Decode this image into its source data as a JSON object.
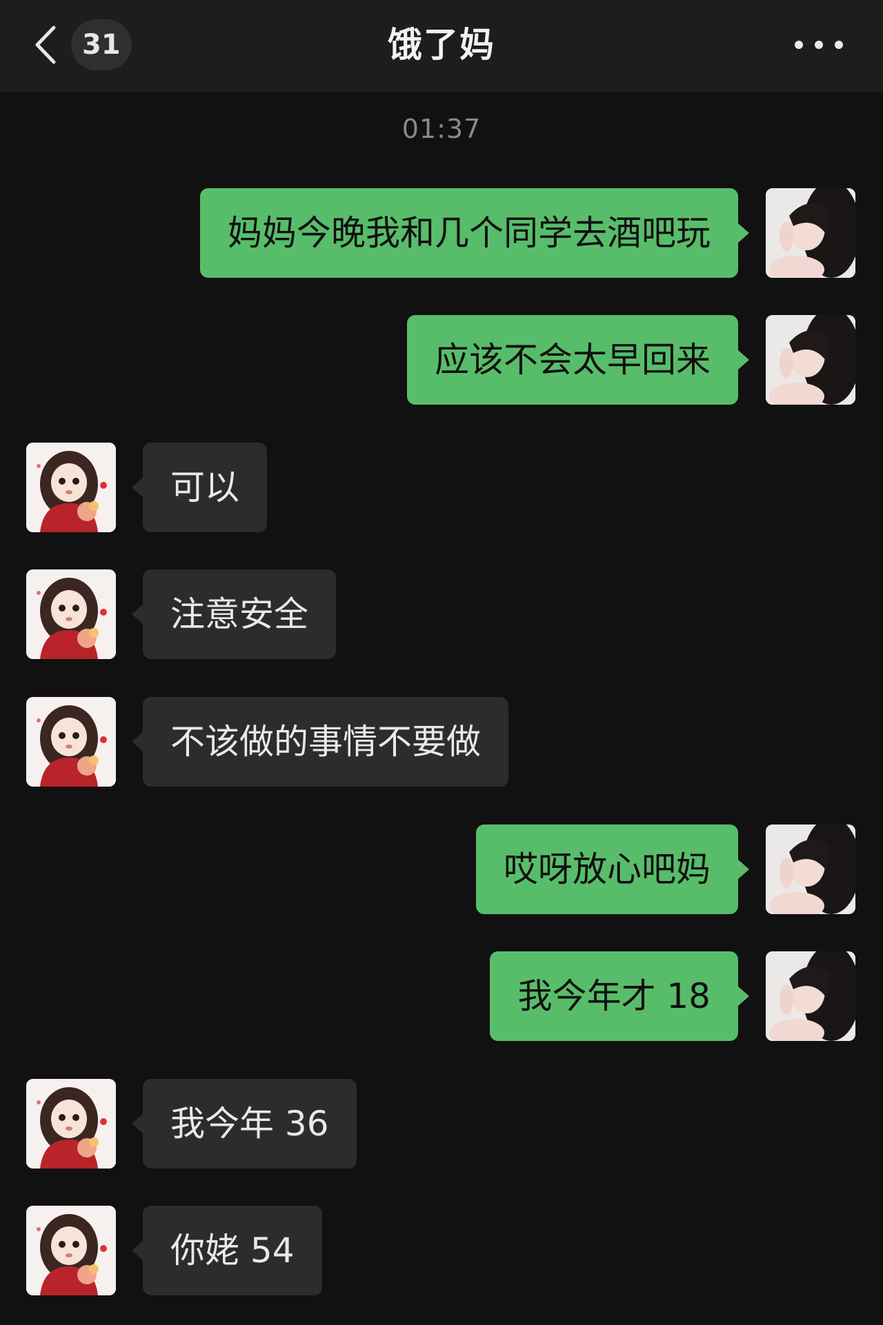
{
  "header": {
    "unread_count": "31",
    "title": "饿了妈"
  },
  "timestamp": "01:37",
  "messages": [
    {
      "side": "out",
      "text": "妈妈今晚我和几个同学去酒吧玩"
    },
    {
      "side": "out",
      "text": "应该不会太早回来"
    },
    {
      "side": "in",
      "text": "可以"
    },
    {
      "side": "in",
      "text": "注意安全"
    },
    {
      "side": "in",
      "text": "不该做的事情不要做"
    },
    {
      "side": "out",
      "text": "哎呀放心吧妈"
    },
    {
      "side": "out",
      "text": "我今年才 18"
    },
    {
      "side": "in",
      "text": "我今年 36"
    },
    {
      "side": "in",
      "text": "你姥 54"
    }
  ],
  "colors": {
    "background": "#111111",
    "header": "#1d1d1d",
    "outgoing_bubble": "#58bd6a",
    "incoming_bubble": "#2c2c2c"
  },
  "icons": [
    "back-chevron-icon",
    "more-options-icon"
  ]
}
